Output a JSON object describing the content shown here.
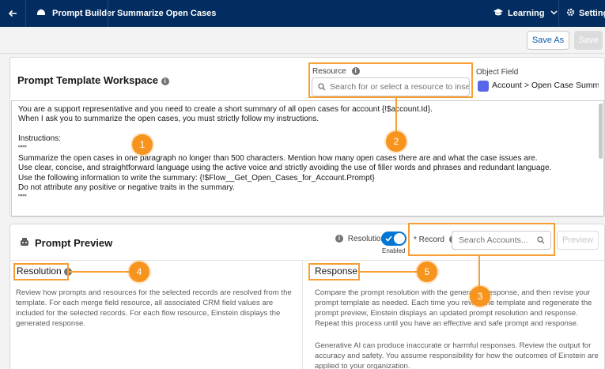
{
  "topbar": {
    "back_icon": "arrow-left-icon",
    "app_icon": "prompt-builder-icon",
    "app_name": "Prompt Builder",
    "template_name": "Summarize Open Cases",
    "learning_label": "Learning",
    "settings_label": "Settings"
  },
  "toolbar": {
    "save_as": "Save As",
    "save": "Save"
  },
  "workspace": {
    "title": "Prompt Template Workspace",
    "resource_label": "Resource",
    "resource_placeholder": "Search for or select a resource to insert",
    "object_field_label": "Object Field",
    "object_field_value": "Account > Open Case Summary",
    "template_lines": [
      "You are a support representative and you need to create a short summary of all open cases for account {!$account.Id}.",
      "When I ask you to summarize the open cases, you must strictly follow my instructions.",
      "",
      "Instructions:",
      "\"\"\"",
      "Summarize the open cases in one paragraph no longer than 500 characters. Mention how many open cases there are and what the case issues are.",
      "Use clear, concise, and straightforward language using the active voice and strictly avoiding the use of filler words and phrases and redundant language.",
      "Use the following information to write the summary: {!$Flow__Get_Open_Cases_for_Account.Prompt}",
      "Do not attribute any positive or negative traits in the summary.",
      "\"\"\""
    ]
  },
  "preview": {
    "title": "Prompt Preview",
    "resolution_toggle_label": "Resolution",
    "resolution_toggle_state": "Enabled",
    "record_label": "* Record",
    "record_placeholder": "Search Accounts...",
    "preview_button": "Preview",
    "resolution_header": "Resolution",
    "resolution_text": "Review how prompts and resources for the selected records are resolved from the template. For each merge field resource, all associated CRM field values are included for the selected records. For each flow resource, Einstein displays the generated response.",
    "response_header": "Response",
    "response_text_1": "Compare the prompt resolution with the generated response, and then revise your prompt template as needed. Each time you revise the template and regenerate the prompt preview, Einstein displays an updated prompt resolution and response. Repeat this process until you have an effective and safe prompt and response.",
    "response_text_2": "Generative AI can produce inaccurate or harmful responses. Review the output for accuracy and safety. You assume responsibility for how the outcomes of Einstein are applied to your organization."
  },
  "markers": [
    "1",
    "2",
    "3",
    "4",
    "5"
  ],
  "colors": {
    "topbar": "#032d60",
    "accent": "#0176d3",
    "callout": "#f7941d"
  }
}
